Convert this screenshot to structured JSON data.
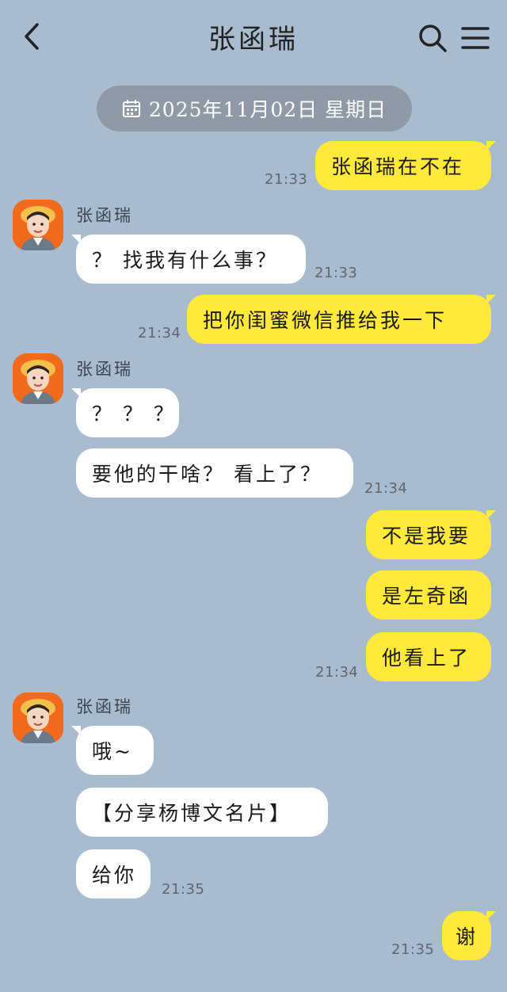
{
  "header": {
    "title": "张函瑞",
    "back_icon": "chevron-left-icon",
    "search_icon": "search-icon",
    "menu_icon": "hamburger-menu-icon"
  },
  "date_separator": {
    "icon": "calendar-icon",
    "text": "2025年11月02日 星期日"
  },
  "contact": {
    "name": "张函瑞"
  },
  "messages": [
    {
      "side": "out",
      "text": "张函瑞在不在",
      "time": "21:33"
    },
    {
      "side": "in",
      "text": "？ 找我有什么事？",
      "time": "21:33"
    },
    {
      "side": "out",
      "text": "把你闺蜜微信推给我一下",
      "time": "21:34"
    },
    {
      "side": "in",
      "text": "？ ？ ？",
      "time": ""
    },
    {
      "side": "in",
      "text": "要他的干啥？ 看上了？",
      "time": "21:34"
    },
    {
      "side": "out",
      "text": "不是我要",
      "time": ""
    },
    {
      "side": "out",
      "text": "是左奇函",
      "time": ""
    },
    {
      "side": "out",
      "text": "他看上了",
      "time": "21:34"
    },
    {
      "side": "in",
      "text": "哦~",
      "time": ""
    },
    {
      "side": "in",
      "text": "【分享杨博文名片】",
      "time": ""
    },
    {
      "side": "in",
      "text": "给你",
      "time": "21:35"
    },
    {
      "side": "out",
      "text": "谢",
      "time": "21:35"
    }
  ],
  "colors": {
    "background": "#a9bccf",
    "outgoing_bubble": "#ffe93a",
    "incoming_bubble": "#ffffff",
    "date_pill": "#8e9ba6"
  }
}
